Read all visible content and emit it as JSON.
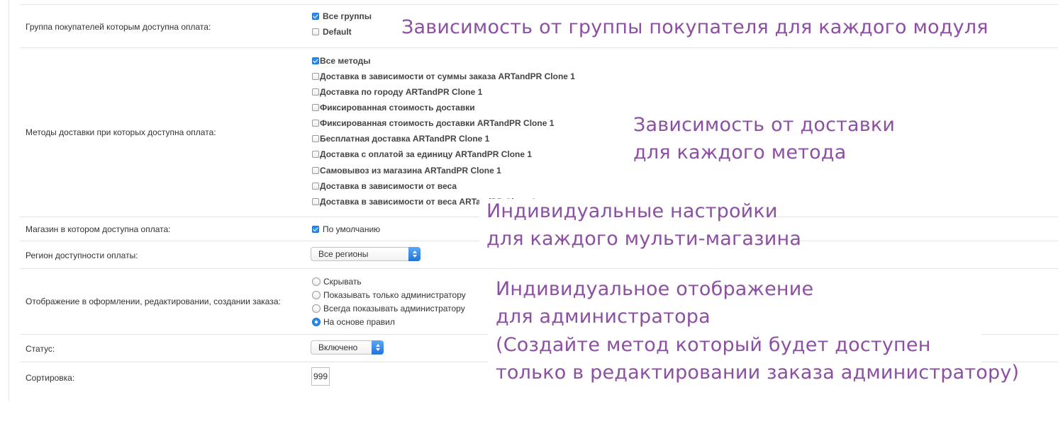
{
  "fields": {
    "customer_group": {
      "label": "Группа покупателей которым доступна оплата:",
      "options": [
        {
          "text": "Все группы",
          "checked": true
        },
        {
          "text": "Default",
          "checked": false
        }
      ]
    },
    "shipping_methods": {
      "label": "Методы доставки при которых доступна оплата:",
      "options": [
        {
          "text": "Все методы",
          "checked": true
        },
        {
          "text": "Доставка в зависимости от суммы заказа ARTandPR Clone 1",
          "checked": false
        },
        {
          "text": "Доставка по городу ARTandPR Clone 1",
          "checked": false
        },
        {
          "text": "Фиксированная стоимость доставки",
          "checked": false
        },
        {
          "text": "Фиксированная стоимость доставки ARTandPR Clone 1",
          "checked": false
        },
        {
          "text": "Бесплатная доставка ARTandPR Clone 1",
          "checked": false
        },
        {
          "text": "Доставка с оплатой за единицу ARTandPR Clone 1",
          "checked": false
        },
        {
          "text": "Самовывоз из магазина ARTandPR Clone 1",
          "checked": false
        },
        {
          "text": "Доставка в зависимости от веса",
          "checked": false
        },
        {
          "text": "Доставка в зависимости от веса ARTandPR Clone 1",
          "checked": false
        }
      ]
    },
    "store": {
      "label": "Магазин в котором доступна оплата:",
      "options": [
        {
          "text": "По умолчанию",
          "checked": true
        }
      ]
    },
    "region": {
      "label": "Регион доступности оплаты:",
      "selected": "Все регионы"
    },
    "display": {
      "label": "Отображение в оформлении, редактировании, создании заказа:",
      "options": [
        {
          "text": "Скрывать",
          "checked": false
        },
        {
          "text": "Показывать только администратору",
          "checked": false
        },
        {
          "text": "Всегда показывать администратору",
          "checked": false
        },
        {
          "text": "На основе правил",
          "checked": true
        }
      ]
    },
    "status": {
      "label": "Статус:",
      "selected": "Включено"
    },
    "sort": {
      "label": "Сортировка:",
      "value": "999"
    }
  },
  "annotations": {
    "group": "Зависимость от группы покупателя для каждого модуля",
    "shipping_1": "Зависимость от доставки",
    "shipping_2": "для каждого метода",
    "store_1": "Индивидуальные настройки",
    "store_2": "для каждого мульти-магазина",
    "admin_1": "Индивидуальное отображение",
    "admin_2": "для администратора",
    "admin_3": "(Создайте метод который будет доступен",
    "admin_4": "только в редактировании заказа администратору)"
  },
  "colors": {
    "annotation": "#8d4fa3",
    "accent": "#2a8cf0"
  }
}
